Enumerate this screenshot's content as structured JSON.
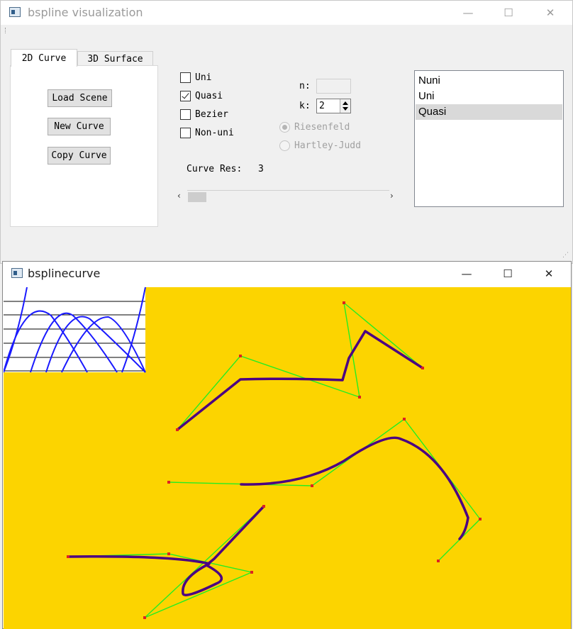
{
  "main_window": {
    "title": "bspline visualization",
    "controls": {
      "minimize": "—",
      "maximize": "☐",
      "close": "✕"
    },
    "tabs": [
      {
        "label": "2D Curve",
        "active": true
      },
      {
        "label": "3D Surface",
        "active": false
      }
    ],
    "buttons": {
      "load_scene": "Load Scene",
      "new_curve": "New Curve",
      "copy_curve": "Copy Curve"
    },
    "checkboxes": [
      {
        "label": "Uni",
        "checked": false
      },
      {
        "label": "Quasi",
        "checked": true
      },
      {
        "label": "Bezier",
        "checked": false
      },
      {
        "label": "Non-uni",
        "checked": false
      }
    ],
    "n_label": "n:",
    "n_value": "",
    "k_label": "k:",
    "k_value": "2",
    "radios": [
      {
        "label": "Riesenfeld",
        "selected": true,
        "enabled": false
      },
      {
        "label": "Hartley-Judd",
        "selected": false,
        "enabled": false
      }
    ],
    "curve_res_label": "Curve Res:",
    "curve_res_value": "3",
    "list_items": [
      {
        "label": "Nuni",
        "selected": false
      },
      {
        "label": "Uni",
        "selected": false
      },
      {
        "label": "Quasi",
        "selected": true
      }
    ]
  },
  "curve_window": {
    "title": "bsplinecurve",
    "controls": {
      "minimize": "—",
      "maximize": "☐",
      "close": "✕"
    },
    "colors": {
      "background": "#fcd400",
      "curve": "#4b0082",
      "control_polygon": "#22ee22",
      "control_point": "#dd2222",
      "basis_curve": "#1a1aff",
      "basis_panel": "#ffffff"
    }
  }
}
